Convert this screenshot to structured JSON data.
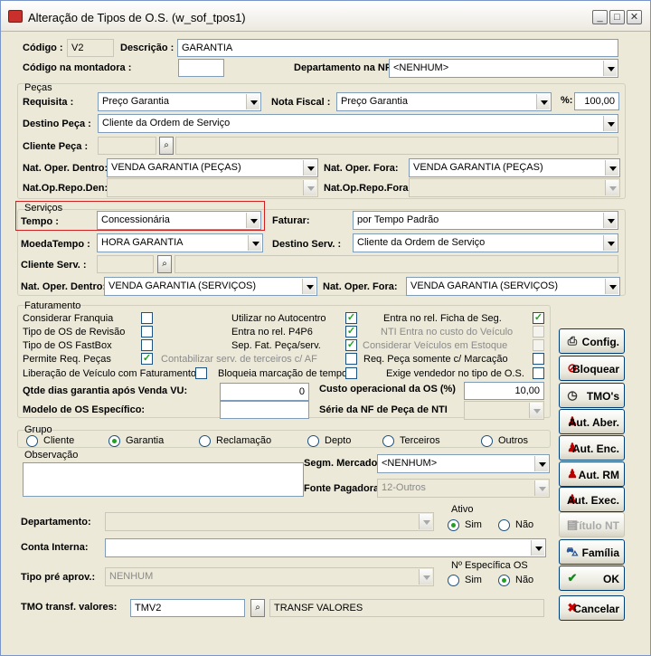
{
  "window": {
    "title": "Alteração de Tipos de O.S. (w_sof_tpos1)",
    "min": "_",
    "max": "□",
    "close": "✕"
  },
  "codigo": {
    "label": "Código :",
    "value": "V2"
  },
  "descricao": {
    "label": "Descrição :",
    "value": "GARANTIA"
  },
  "codigo_montadora": {
    "label": "Código na montadora :",
    "value": ""
  },
  "depto_nf": {
    "label": "Departamento na NF:",
    "value": "<NENHUM>"
  },
  "pecas": {
    "group_label": "Peças",
    "requisita": {
      "label": "Requisita :",
      "value": "Preço Garantia"
    },
    "nota_fiscal": {
      "label": "Nota Fiscal :",
      "value": "Preço Garantia"
    },
    "percent": {
      "label": "%:",
      "value": "100,00"
    },
    "destino": {
      "label": "Destino Peça :",
      "value": "Cliente da Ordem de Serviço"
    },
    "cliente": {
      "label": "Cliente Peça :"
    },
    "nat_dentro": {
      "label": "Nat. Oper. Dentro:",
      "value": "VENDA GARANTIA (PEÇAS)"
    },
    "nat_fora": {
      "label": "Nat. Oper. Fora:",
      "value": "VENDA GARANTIA (PEÇAS)"
    },
    "repo_den": {
      "label": "Nat.Op.Repo.Den:"
    },
    "repo_fora": {
      "label": "Nat.Op.Repo.Fora:"
    }
  },
  "servicos": {
    "group_label": "Serviços",
    "tempo": {
      "label": "Tempo :",
      "value": "Concessionária"
    },
    "faturar": {
      "label": "Faturar:",
      "value": "por Tempo Padrão"
    },
    "moeda": {
      "label": "MoedaTempo :",
      "value": "HORA GARANTIA"
    },
    "destino": {
      "label": "Destino Serv. :",
      "value": "Cliente da Ordem de Serviço"
    },
    "cliente": {
      "label": "Cliente Serv. :"
    },
    "nat_dentro": {
      "label": "Nat. Oper. Dentro:",
      "value": "VENDA GARANTIA (SERVIÇOS)"
    },
    "nat_fora": {
      "label": "Nat. Oper. Fora:",
      "value": "VENDA GARANTIA (SERVIÇOS)"
    }
  },
  "faturamento": {
    "group_label": "Faturamento",
    "col1": [
      {
        "label": "Considerar Franquia",
        "checked": false
      },
      {
        "label": "Tipo de OS de Revisão",
        "checked": false
      },
      {
        "label": "Tipo de OS FastBox",
        "checked": false
      },
      {
        "label": "Permite Req. Peças",
        "checked": true
      }
    ],
    "col2": [
      {
        "label": "Utilizar no Autocentro",
        "checked": true
      },
      {
        "label": "Entra no rel. P4P6",
        "checked": true
      },
      {
        "label": "Sep. Fat. Peça/serv.",
        "checked": true
      },
      {
        "label": "Contabilizar serv. de terceiros c/ AF",
        "checked": false
      }
    ],
    "col3": [
      {
        "label": "Entra no rel. Ficha de Seg.",
        "checked": true
      },
      {
        "label": "NTI Entra no custo do Veículo",
        "checked": false
      },
      {
        "label": "Considerar Veículos em Estoque",
        "checked": false
      },
      {
        "label": "Req. Peça somente c/ Marcação",
        "checked": false
      }
    ],
    "liberacao": "Liberação de Veículo com Faturamento",
    "bloqueia": "Bloqueia marcação de tempo",
    "exige": "Exige vendedor no tipo de O.S.",
    "qtde": {
      "label": "Qtde dias garantia após Venda VU:",
      "value": "0"
    },
    "custo": {
      "label": "Custo operacional da OS (%)",
      "value": "10,00"
    },
    "modelo": {
      "label": "Modelo de OS Específico:",
      "value": ""
    },
    "serie": {
      "label": "Série da NF de Peça de NTI",
      "value": ""
    }
  },
  "grupo": {
    "group_label": "Grupo",
    "options": [
      "Cliente",
      "Garantia",
      "Reclamação",
      "Depto",
      "Terceiros",
      "Outros"
    ],
    "selected": "Garantia"
  },
  "observacao": {
    "label": "Observação",
    "value": ""
  },
  "segm": {
    "label": "Segm. Mercado:",
    "value": "<NENHUM>"
  },
  "fonte": {
    "label": "Fonte Pagadora:",
    "value": "12-Outros"
  },
  "departamento": {
    "label": "Departamento:",
    "value": ""
  },
  "ativo": {
    "label": "Ativo",
    "sim": "Sim",
    "nao": "Não",
    "selected": "Sim"
  },
  "conta": {
    "label": "Conta Interna:",
    "value": ""
  },
  "tipo_pre": {
    "label": "Tipo pré aprov.:",
    "value": "NENHUM"
  },
  "especifica": {
    "label": "Nº Específica OS",
    "sim": "Sim",
    "nao": "Não",
    "selected": "Não"
  },
  "tmo": {
    "label": "TMO transf. valores:",
    "code": "TMV2",
    "desc": "TRANSF VALORES"
  },
  "buttons": [
    {
      "key": "config",
      "label": "Config.",
      "icon": "printer-icon"
    },
    {
      "key": "bloquear",
      "label": "Bloquear",
      "icon": "block-icon"
    },
    {
      "key": "tmos",
      "label": "TMO's",
      "icon": "clock-icon"
    },
    {
      "key": "aut_aber",
      "label": "Aut. Aber.",
      "icon": "person-icon"
    },
    {
      "key": "aut_enc",
      "label": "Aut. Enc.",
      "icon": "person-icon"
    },
    {
      "key": "aut_rm",
      "label": "Aut. RM",
      "icon": "person-icon"
    },
    {
      "key": "aut_exec",
      "label": "Aut. Exec.",
      "icon": "person-icon"
    },
    {
      "key": "titulo_nt",
      "label": "Título NT",
      "icon": "doc-icon"
    },
    {
      "key": "familia",
      "label": "Família",
      "icon": "car-icon"
    },
    {
      "key": "ok",
      "label": "OK",
      "icon": "check-icon"
    },
    {
      "key": "cancelar",
      "label": "Cancelar",
      "icon": "x-icon"
    }
  ],
  "accent": "#d00000"
}
